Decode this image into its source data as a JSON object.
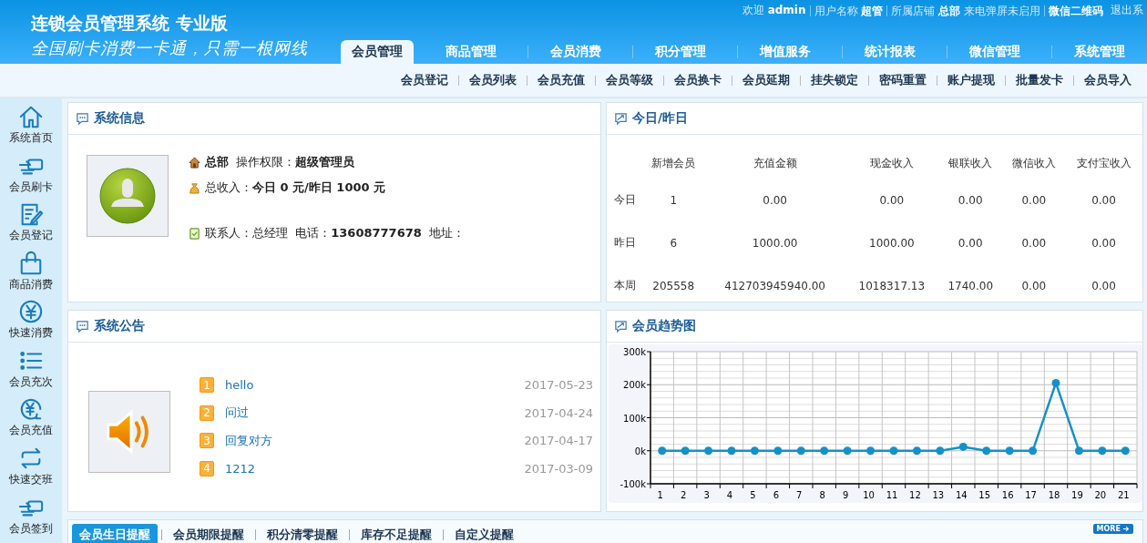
{
  "header": {
    "title": "连锁会员管理系统 专业版",
    "slogan": "全国刷卡消费一卡通，只需一根网线",
    "user_bar": [
      {
        "kind": "text",
        "text": "欢迎 **admin**",
        "sep": false
      },
      {
        "kind": "text",
        "text": "用户名称 **超管**",
        "sep": true
      },
      {
        "kind": "text",
        "text": "所属店铺 **总部** 来电弹屏未启用",
        "sep": true
      },
      {
        "kind": "link",
        "text": "微信二维码",
        "bold": true,
        "sep": true
      },
      {
        "kind": "link",
        "text": "退出系",
        "bold": false,
        "sep": false
      }
    ]
  },
  "main_tabs": [
    {
      "label": "会员管理",
      "selected": true
    },
    {
      "label": "商品管理",
      "selected": false
    },
    {
      "label": "会员消费",
      "selected": false
    },
    {
      "label": "积分管理",
      "selected": false
    },
    {
      "label": "增值服务",
      "selected": false
    },
    {
      "label": "统计报表",
      "selected": false
    },
    {
      "label": "微信管理",
      "selected": false
    },
    {
      "label": "系统管理",
      "selected": false
    }
  ],
  "sub_nav": [
    "会员登记",
    "会员列表",
    "会员充值",
    "会员等级",
    "会员换卡",
    "会员延期",
    "挂失锁定",
    "密码重置",
    "账户提现",
    "批量发卡",
    "会员导入"
  ],
  "sidebar": {
    "items": [
      "系统首页",
      "会员刷卡",
      "会员登记",
      "商品消费",
      "快速消费",
      "会员充次",
      "会员充值",
      "快速交班",
      "会员签到"
    ]
  },
  "system_info": {
    "title": "系统信息",
    "lines": [
      {
        "kind": "house",
        "text": "**总部**  操作权限：**超级管理员**"
      },
      {
        "kind": "money",
        "text": "总收入：**今日 0 元/昨日 1000 元**"
      },
      {
        "kind": "contact",
        "text": "联系人：总经理  电话：**13608777678**  地址："
      }
    ]
  },
  "today_yesterday": {
    "title": "今日/昨日",
    "columns": [
      "新增会员",
      "充值金额",
      "现金收入",
      "银联收入",
      "微信收入",
      "支付宝收入"
    ],
    "rows": [
      {
        "label": "今日",
        "values": [
          "1",
          "0.00",
          "0.00",
          "0.00",
          "0.00",
          "0.00"
        ]
      },
      {
        "label": "昨日",
        "values": [
          "6",
          "1000.00",
          "1000.00",
          "0.00",
          "0.00",
          "0.00"
        ]
      },
      {
        "label": "本周",
        "values": [
          "205558",
          "412703945940.00",
          "1018317.13",
          "1740.00",
          "0.00",
          "0.00"
        ]
      }
    ]
  },
  "announcements": {
    "title": "系统公告",
    "items": [
      {
        "number": "1",
        "title": "hello",
        "date": "2017-05-23"
      },
      {
        "number": "2",
        "title": "问过",
        "date": "2017-04-24"
      },
      {
        "number": "3",
        "title": "回复对方",
        "date": "2017-04-17"
      },
      {
        "number": "4",
        "title": "1212",
        "date": "2017-03-09"
      }
    ]
  },
  "member_trend": {
    "title": "会员趋势图",
    "chart_data": {
      "type": "line",
      "x": [
        "1",
        "2",
        "3",
        "4",
        "5",
        "6",
        "7",
        "8",
        "9",
        "10",
        "11",
        "12",
        "13",
        "14",
        "15",
        "16",
        "17",
        "18",
        "19",
        "20",
        "21"
      ],
      "grid": true,
      "series": [
        {
          "color": "#1690c8",
          "marker": "circle",
          "values": [
            0,
            0,
            0,
            0,
            0,
            0,
            0,
            0,
            0,
            0,
            0,
            0,
            0,
            12000,
            0,
            0,
            0,
            205000,
            0,
            0,
            0
          ]
        }
      ],
      "ylim": [
        -100000,
        300000
      ],
      "yticks": [
        {
          "value": -100000,
          "label": "-100k"
        },
        {
          "value": 0,
          "label": "0k"
        },
        {
          "value": 100000,
          "label": "100k"
        },
        {
          "value": 200000,
          "label": "200k"
        },
        {
          "value": 300000,
          "label": "300k"
        }
      ]
    }
  },
  "reminders": {
    "tabs": [
      {
        "label": "会员生日提醒",
        "selected": true
      },
      {
        "label": "会员期限提醒",
        "selected": false
      },
      {
        "label": "积分清零提醒",
        "selected": false
      },
      {
        "label": "库存不足提醒",
        "selected": false
      },
      {
        "label": "自定义提醒",
        "selected": false
      }
    ],
    "more": "MORE"
  }
}
